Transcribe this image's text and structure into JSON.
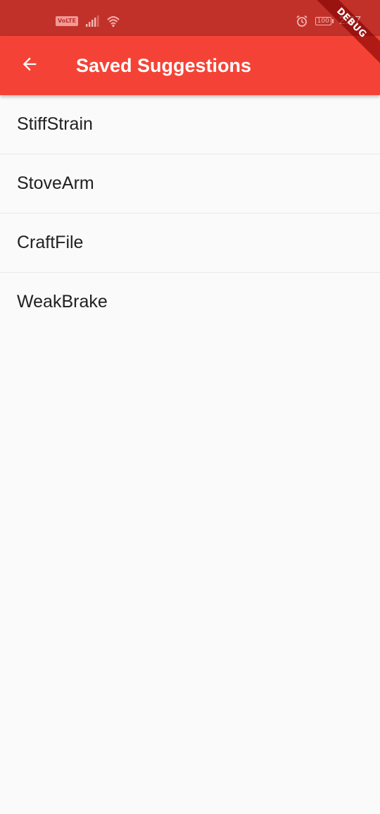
{
  "status_bar": {
    "volte": "VoLTE",
    "battery": "100",
    "time": "2:37",
    "icons": [
      "volte-icon",
      "signal-icon",
      "wifi-icon",
      "alarm-icon",
      "battery-icon"
    ],
    "background_color": "#c1312a"
  },
  "app_bar": {
    "title": "Saved Suggestions",
    "back_icon": "arrow-back-icon",
    "background_color": "#f44336"
  },
  "debug_banner": {
    "label": "DEBUG"
  },
  "saved_list": {
    "items": [
      {
        "label": "StiffStrain"
      },
      {
        "label": "StoveArm"
      },
      {
        "label": "CraftFile"
      },
      {
        "label": "WeakBrake"
      }
    ]
  }
}
